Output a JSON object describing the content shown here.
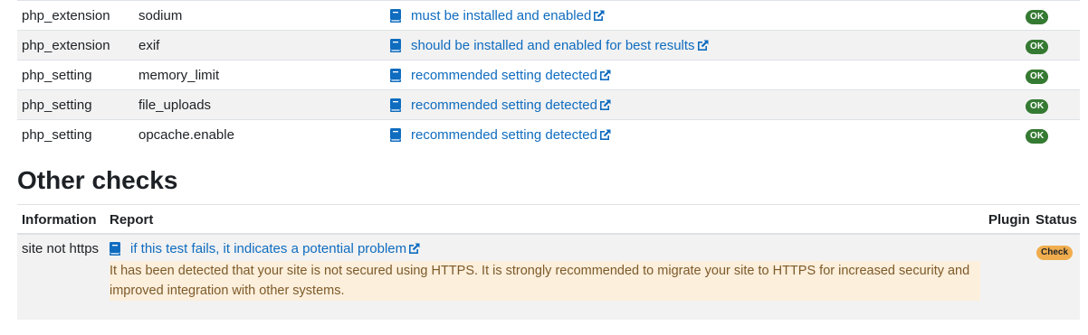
{
  "environment_table": {
    "rows": [
      {
        "type": "php_extension",
        "name": "sodium",
        "report": "must be installed and enabled",
        "status": "OK"
      },
      {
        "type": "php_extension",
        "name": "exif",
        "report": "should be installed and enabled for best results",
        "status": "OK"
      },
      {
        "type": "php_setting",
        "name": "memory_limit",
        "report": "recommended setting detected",
        "status": "OK"
      },
      {
        "type": "php_setting",
        "name": "file_uploads",
        "report": "recommended setting detected",
        "status": "OK"
      },
      {
        "type": "php_setting",
        "name": "opcache.enable",
        "report": "recommended setting detected",
        "status": "OK"
      }
    ]
  },
  "other_checks": {
    "heading": "Other checks",
    "headers": {
      "information": "Information",
      "report": "Report",
      "plugin": "Plugin",
      "status": "Status"
    },
    "rows": [
      {
        "information": "site not https",
        "report_link": "if this test fails, it indicates a potential problem",
        "warning": "It has been detected that your site is not secured using HTTPS. It is strongly recommended to migrate your site to HTTPS for increased security and improved integration with other systems.",
        "plugin": "",
        "status": "Check"
      }
    ]
  },
  "colors": {
    "link": "#0f6cbf",
    "ok_badge": "#357a32",
    "check_badge": "#f0ad4e",
    "warning_bg": "#fcefdc",
    "warning_text": "#7d5a29",
    "stripe": "#f2f2f2"
  },
  "icons": {
    "report_icon": "book-icon",
    "external_link_icon": "external-link-icon"
  }
}
